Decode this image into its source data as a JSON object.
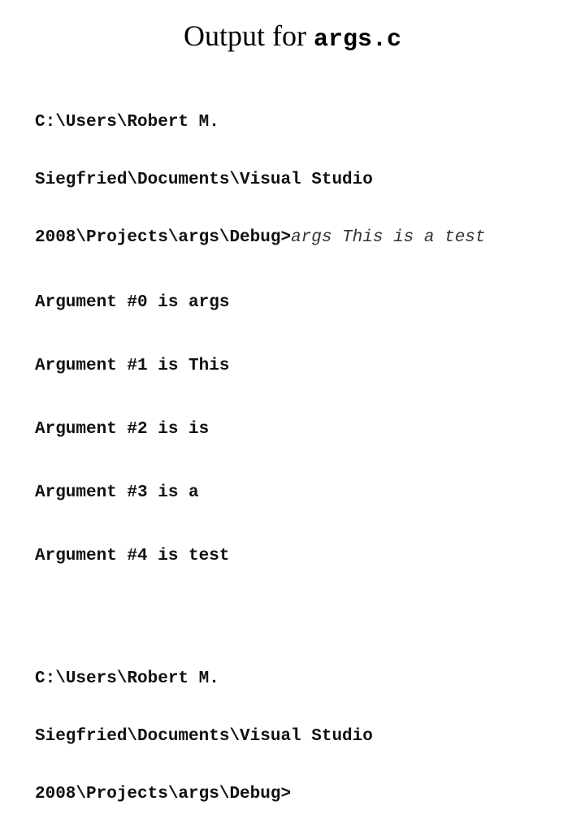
{
  "title": {
    "text": "Output for ",
    "code": "args.c"
  },
  "console": {
    "session1": {
      "prompt_lines": [
        "C:\\Users\\Robert M.",
        "Siegfried\\Documents\\Visual Studio",
        "2008\\Projects\\args\\Debug>"
      ],
      "command": "args This is a test"
    },
    "output_lines": [
      "Argument #0 is args",
      "Argument #1 is This",
      "Argument #2 is is",
      "Argument #3 is a",
      "Argument #4 is test"
    ],
    "session2": {
      "prompt_lines": [
        "C:\\Users\\Robert M.",
        "Siegfried\\Documents\\Visual Studio",
        "2008\\Projects\\args\\Debug>"
      ]
    }
  }
}
